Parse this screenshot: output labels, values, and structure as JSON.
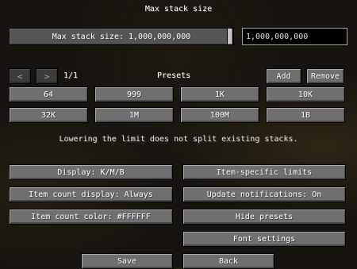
{
  "screen": {
    "title": "Max stack size"
  },
  "stack_size": {
    "slider_label": "Max stack size: 1,000,000,000",
    "input_value": "1,000,000,000"
  },
  "presets": {
    "prev_icon": "left-arrow-icon",
    "next_icon": "right-arrow-icon",
    "prev_glyph": "<",
    "next_glyph": ">",
    "page_indicator": "1/1",
    "heading": "Presets",
    "add_label": "Add",
    "remove_label": "Remove",
    "row1": [
      "64",
      "999",
      "1K",
      "10K"
    ],
    "row2": [
      "32K",
      "1M",
      "100M",
      "1B"
    ]
  },
  "note": "Lowering the limit does not split existing stacks.",
  "options": {
    "display": "Display: K/M/B",
    "item_specific_limits": "Item-specific limits",
    "item_count_display": "Item count display: Always",
    "update_notifications": "Update notifications: On",
    "item_count_color": "Item count color: #FFFFFF",
    "hide_presets": "Hide presets",
    "font_settings": "Font settings"
  },
  "footer": {
    "save_label": "Save",
    "back_label": "Back"
  }
}
